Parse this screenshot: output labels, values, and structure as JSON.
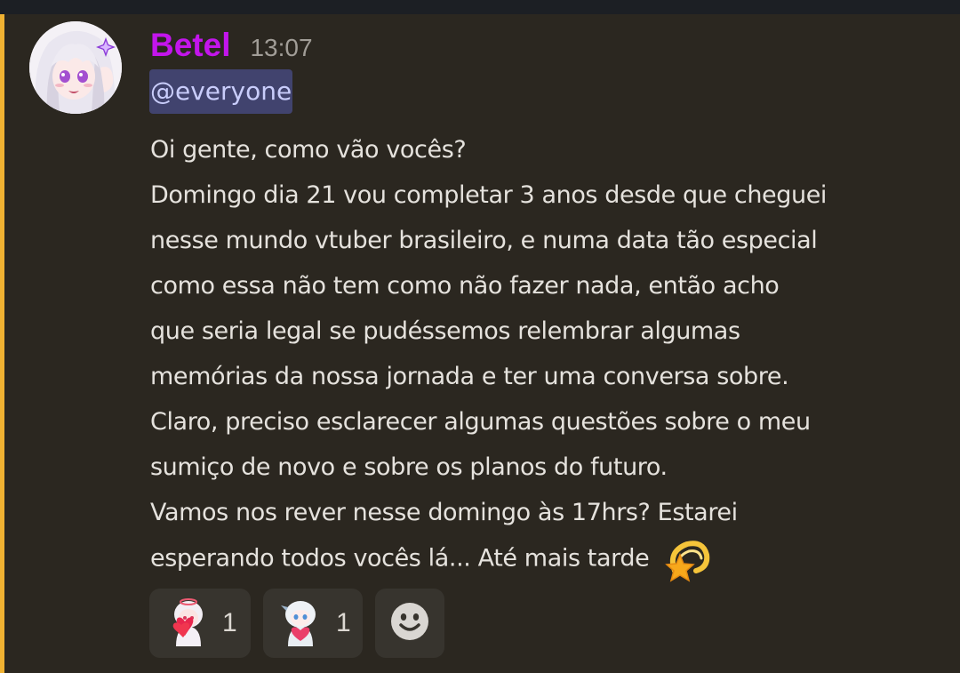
{
  "message": {
    "author": "Betel",
    "timestamp": "13:07",
    "mention": "@everyone",
    "lines": [
      "Oi gente, como vão vocês?",
      "Domingo dia 21 vou completar 3 anos desde que cheguei",
      "nesse mundo vtuber brasileiro, e numa data tão especial",
      "como essa não tem como não fazer nada, então acho",
      "que seria legal se pudéssemos relembrar algumas",
      "memórias da nossa jornada e ter uma conversa sobre.",
      "Claro, preciso esclarecer algumas questões sobre o meu",
      "sumiço de novo e sobre os planos do futuro.",
      "Vamos nos rever nesse domingo às 17hrs? Estarei",
      "esperando todos vocês lá... Até mais tarde"
    ],
    "trailing_emoji": "dizzy-star-emoji"
  },
  "reactions": [
    {
      "emoji": "anime-girl-heart-emoji",
      "count": "1"
    },
    {
      "emoji": "chibi-heart-emoji",
      "count": "1"
    },
    {
      "emoji": "add-reaction-smiley-icon"
    }
  ],
  "colors": {
    "background": "#2b2720",
    "mention_bar": "#f0b232",
    "username": "#c315ec",
    "mention_bg": "#41436e",
    "mention_text": "#c9cdfb",
    "text": "#e5e2dd"
  }
}
